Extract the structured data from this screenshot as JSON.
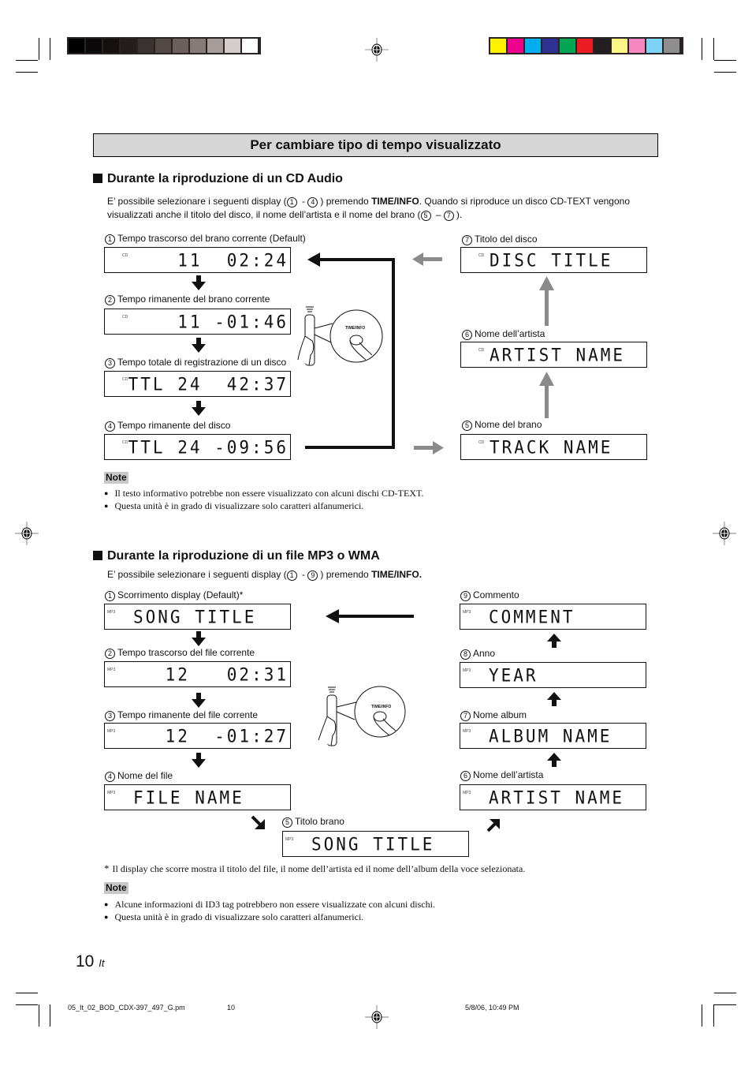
{
  "colors": {
    "gray_swatches": [
      "#000000",
      "#0b0909",
      "#141110",
      "#231e1d",
      "#3a3230",
      "#524844",
      "#6b605d",
      "#857b78",
      "#a69d9b",
      "#d3cccb",
      "#ffffff"
    ],
    "color_swatches": [
      "#fff100",
      "#ec008c",
      "#00aeef",
      "#2e3192",
      "#00a651",
      "#ed1c24",
      "#231f20",
      "#fff685",
      "#f587c1",
      "#7fd3f7",
      "#8f8e8e"
    ],
    "title_bg": "#d6d6d6",
    "gray_arrow": "#8a8a8a"
  },
  "header": {
    "title": "Per cambiare tipo di tempo visualizzato"
  },
  "cd": {
    "heading": "Durante la riproduzione di un CD Audio",
    "intro_1a": "E’ possibile selezionare i seguenti display (",
    "intro_1b": "1",
    "intro_1c": " - ",
    "intro_1d": "4",
    "intro_1e": ") premendo ",
    "intro_1f": "TIME/INFO",
    "intro_1g": ". Quando si riproduce un disco CD-TEXT vengono",
    "intro_2a": "visualizzati anche il titolo del disco, il nome dell’artista e il nome del brano (",
    "intro_2b": "5",
    "intro_2c": " – ",
    "intro_2d": "7",
    "intro_2e": ").",
    "tag": "CD",
    "remote_button": "TIME/INFO",
    "items": [
      {
        "n": "1",
        "label": "Tempo trascorso del brano corrente (Default)",
        "display": "11  02:24"
      },
      {
        "n": "2",
        "label": "Tempo rimanente del brano corrente",
        "display": "11 -01:46"
      },
      {
        "n": "3",
        "label": "Tempo totale di registrazione di un disco",
        "display": "TTL 24  42:37"
      },
      {
        "n": "4",
        "label": "Tempo rimanente del disco",
        "display": "TTL 24 -09:56"
      },
      {
        "n": "5",
        "label": "Nome del brano",
        "display": "TRACK NAME"
      },
      {
        "n": "6",
        "label": "Nome dell’artista",
        "display": "ARTIST NAME"
      },
      {
        "n": "7",
        "label": "Titolo del disco",
        "display": "DISC TITLE"
      }
    ],
    "note_label": "Note",
    "notes": [
      "Il testo informativo potrebbe non essere visualizzato con alcuni dischi CD-TEXT.",
      "Questa unità è in grado di visualizzare solo caratteri alfanumerici."
    ]
  },
  "mp3": {
    "heading": "Durante la riproduzione di un file MP3 o WMA",
    "intro_a": "E’ possibile selezionare i seguenti display (",
    "intro_b": "1",
    "intro_c": " - ",
    "intro_d": "9",
    "intro_e": ") premendo ",
    "intro_f": "TIME/INFO.",
    "tag": "MP3",
    "remote_button": "TIME/INFO",
    "items": [
      {
        "n": "1",
        "label": "Scorrimento display (Default)*",
        "display": "SONG TITLE"
      },
      {
        "n": "2",
        "label": "Tempo trascorso del file corrente",
        "display": "12   02:31"
      },
      {
        "n": "3",
        "label": "Tempo rimanente del file corrente",
        "display": "12  -01:27"
      },
      {
        "n": "4",
        "label": "Nome del file",
        "display": "FILE NAME"
      },
      {
        "n": "5",
        "label": "Titolo brano",
        "display": "SONG TITLE"
      },
      {
        "n": "6",
        "label": "Nome dell’artista",
        "display": "ARTIST NAME"
      },
      {
        "n": "7",
        "label": "Nome album",
        "display": "ALBUM NAME"
      },
      {
        "n": "8",
        "label": "Anno",
        "display": "YEAR"
      },
      {
        "n": "9",
        "label": "Commento",
        "display": "COMMENT"
      }
    ],
    "footnote_mark": "*",
    "footnote": "Il display che scorre mostra il titolo del file, il nome dell’artista ed il nome dell’album della voce selezionata.",
    "note_label": "Note",
    "notes": [
      "Alcune informazioni di ID3 tag potrebbero non essere visualizzate con alcuni dischi.",
      "Questa unità è in grado di visualizzare solo caratteri alfanumerici."
    ]
  },
  "footer": {
    "page_number": "10",
    "lang": "It",
    "file": "05_It_02_BOD_CDX-397_497_G.pm",
    "page": "10",
    "date": "5/8/06, 10:49 PM"
  }
}
